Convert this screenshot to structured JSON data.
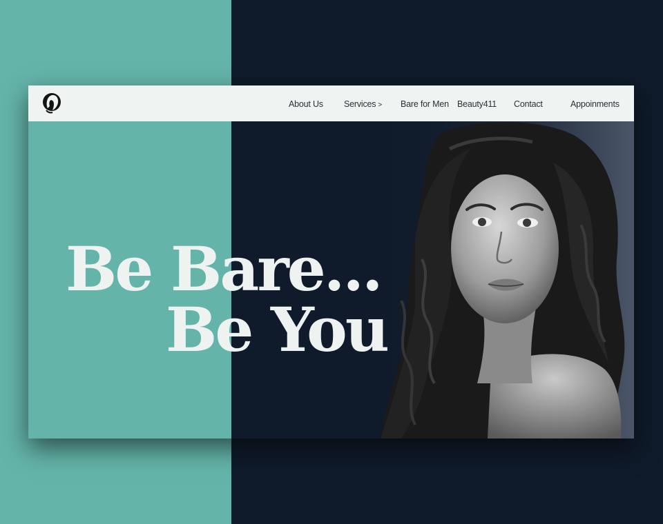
{
  "colors": {
    "teal": "#64b4a9",
    "navy": "#0f1b2a",
    "navbar_bg": "#eff3f2",
    "headline": "#eef3f1"
  },
  "header": {
    "logo_icon": "woman-silhouette-logo-icon",
    "nav": [
      {
        "label": "About Us"
      },
      {
        "label": "Services",
        "icon": "chevron-right-icon",
        "chevron": ">"
      },
      {
        "label": "Bare for Men"
      },
      {
        "label": "Beauty411"
      },
      {
        "label": "Contact"
      },
      {
        "label": "Appoinments"
      }
    ]
  },
  "hero": {
    "headline_line1": "Be Bare...",
    "headline_line2": "Be You",
    "image": "black-and-white-portrait-of-woman-with-long-wavy-hair"
  }
}
